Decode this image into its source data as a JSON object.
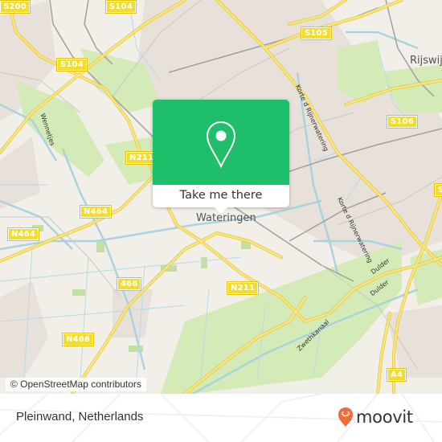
{
  "map": {
    "place_labels": {
      "wateringen": "Wateringen",
      "rijswijk": "Rijswij"
    },
    "road_shields": {
      "s200": "S200",
      "s104_top": "S104",
      "s104_mid": "S104",
      "s105": "S105",
      "s106": "S106",
      "s_right": "S",
      "n211_top": "N211",
      "n211_bottom": "N211",
      "n464_mid": "N464",
      "n464_left": "N464",
      "r466": "466",
      "n466": "N466",
      "a4": "A4"
    },
    "street_labels": {
      "wennetjes": "Wennetjes",
      "korte_rijn_1": "Korte d Rijnerwatering",
      "korte_rijn_2": "Korte d Rijnerwatering",
      "dulder_1": "Dulder",
      "dulder_2": "Dulder",
      "zweth": "Zwethkanaal"
    },
    "colors": {
      "land": "#f2efe9",
      "urban": "#e6dfd8",
      "green": "#cfe8b0",
      "water": "#aad3df",
      "road": "#f6e36a",
      "rail": "#999999"
    }
  },
  "popup": {
    "icon": "map-pin-icon",
    "cta_label": "Take me there",
    "accent": "#1ebe6b"
  },
  "attribution": "© OpenStreetMap contributors",
  "footer": {
    "location": "Pleinwand, Netherlands",
    "brand": "moovit",
    "brand_icon": "moovit-smile-pin-icon",
    "brand_color": "#f26b3a"
  }
}
